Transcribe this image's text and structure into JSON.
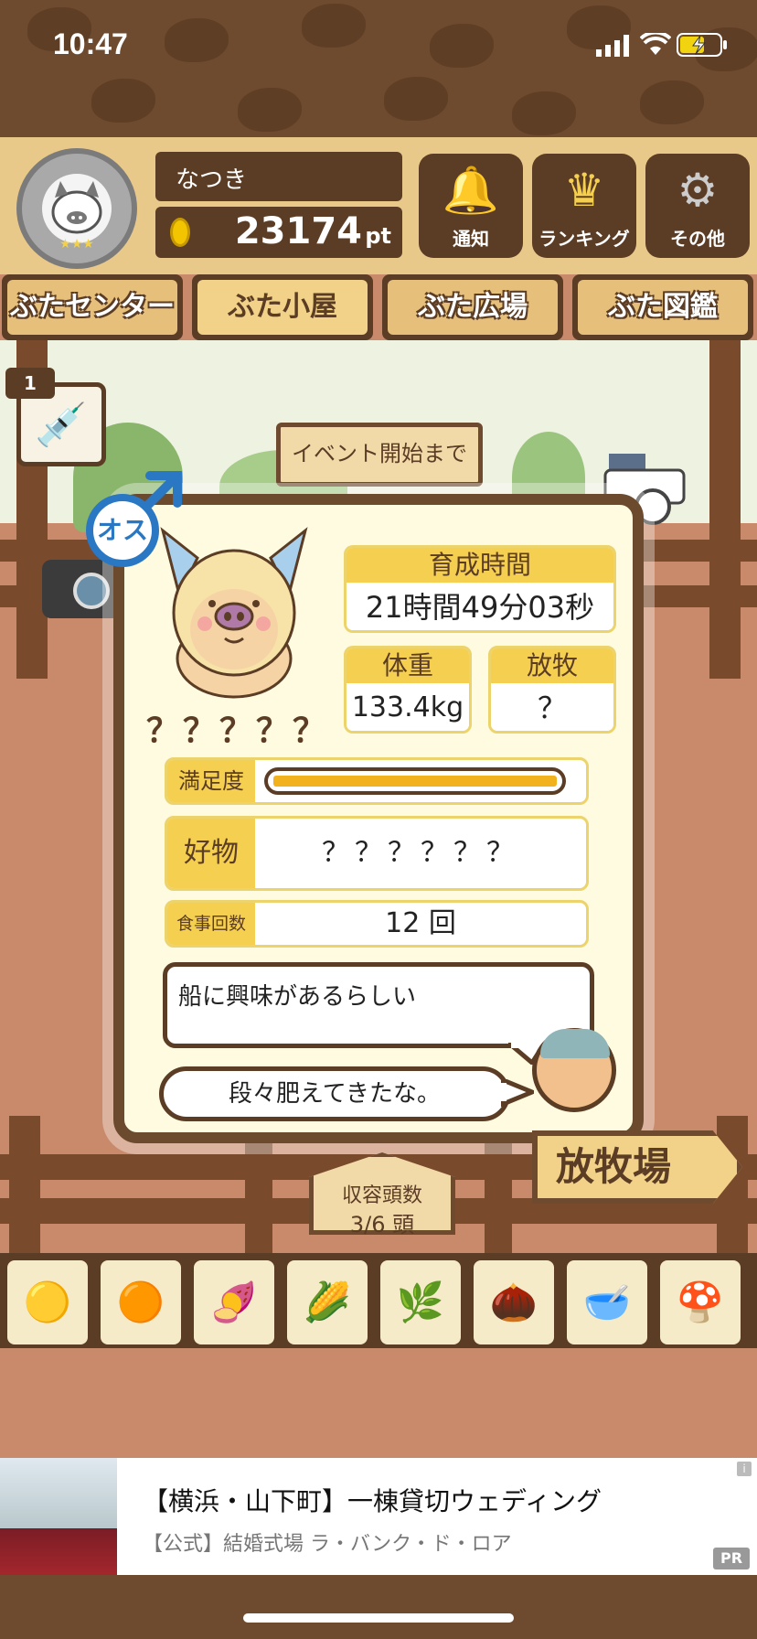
{
  "status_bar": {
    "time": "10:47"
  },
  "header": {
    "player_name": "なつき",
    "points": "23174",
    "points_unit": "pt",
    "buttons": [
      {
        "label": "通知",
        "icon": "bell-icon"
      },
      {
        "label": "ランキング",
        "icon": "crown-icon"
      },
      {
        "label": "その他",
        "icon": "gear-icon"
      }
    ]
  },
  "tabs": [
    {
      "label": "ぶたセンター",
      "active": false
    },
    {
      "label": "ぶた小屋",
      "active": true
    },
    {
      "label": "ぶた広場",
      "active": false
    },
    {
      "label": "ぶた図鑑",
      "active": false
    }
  ],
  "item": {
    "count": "1",
    "icon": "syringe-icon"
  },
  "event_sign": "イベント開始まで",
  "card": {
    "gender": "オス",
    "pig_name": "？？？？？",
    "growth_time": {
      "label": "育成時間",
      "value": "21時間49分03秒"
    },
    "weight": {
      "label": "体重",
      "value": "133.4kg"
    },
    "grazing": {
      "label": "放牧",
      "value": "？"
    },
    "satisfaction": {
      "label": "満足度",
      "level": 1.0
    },
    "favorite": {
      "label": "好物",
      "value": "？？？？？？"
    },
    "meals": {
      "label": "食事回数",
      "value": "12 回"
    },
    "hint_bubble": "船に興味があるらしい",
    "farmer_bubble": "段々肥えてきたな。"
  },
  "capacity": {
    "label": "収容頭数",
    "value": "3/6 頭"
  },
  "ranch_sign": "放牧場",
  "foods": [
    "grain-icon",
    "corn-kernel-icon",
    "sweet-potato-icon",
    "corn-icon",
    "beans-icon",
    "acorn-icon",
    "soybean-icon",
    "truffle-icon"
  ],
  "ad": {
    "title": "【横浜・山下町】一棟貸切ウェディング",
    "subtitle": "【公式】結婚式場 ラ・バンク・ド・ロア",
    "badge": "PR",
    "info": "i"
  },
  "colors": {
    "wood_dark": "#5b3c24",
    "card_bg": "#fffbe0",
    "label_yellow": "#f5cf4f",
    "gender_blue": "#2a78c4"
  }
}
